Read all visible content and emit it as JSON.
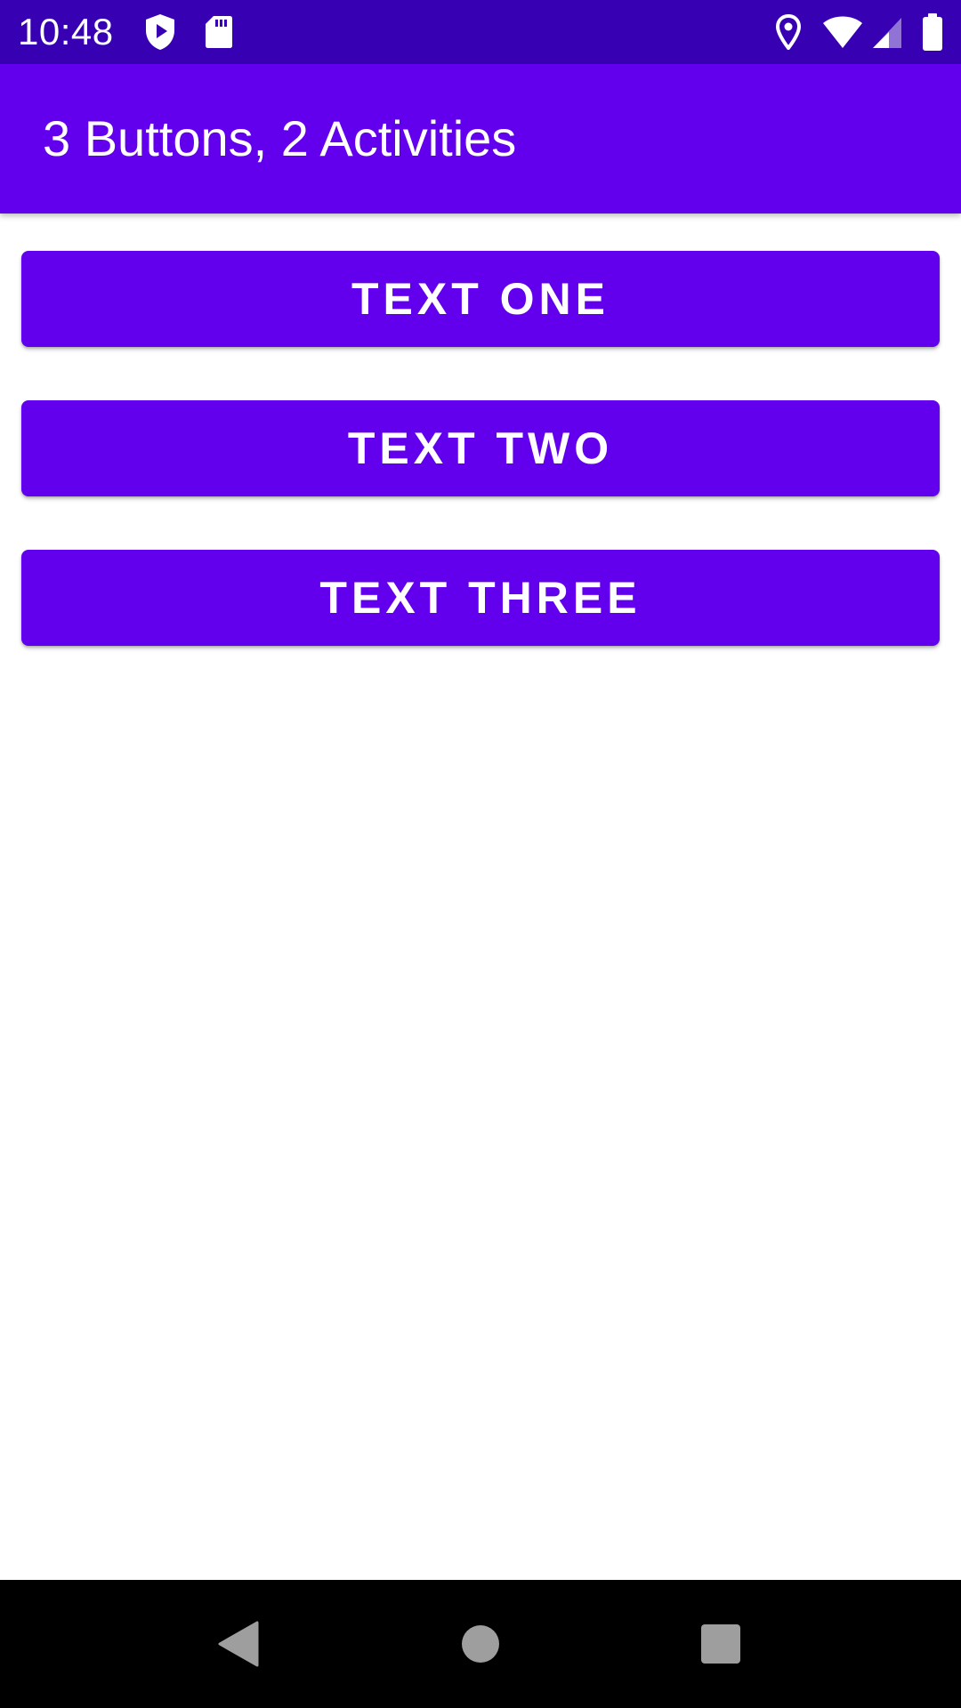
{
  "status_bar": {
    "time": "10:48",
    "icons": [
      "shield-play-icon",
      "sd-card-icon",
      "location-icon",
      "wifi-icon",
      "signal-icon",
      "battery-icon"
    ],
    "background": "#3700b3"
  },
  "app_bar": {
    "title": "3 Buttons, 2 Activities",
    "background": "#6200ee"
  },
  "buttons": [
    {
      "label": "TEXT ONE"
    },
    {
      "label": "TEXT TWO"
    },
    {
      "label": "TEXT THREE"
    }
  ],
  "nav_bar": {
    "icons": [
      "back-icon",
      "home-icon",
      "recents-icon"
    ],
    "background": "#000000"
  },
  "colors": {
    "primary": "#6200ee",
    "primary_dark": "#3700b3",
    "on_primary": "#ffffff"
  }
}
